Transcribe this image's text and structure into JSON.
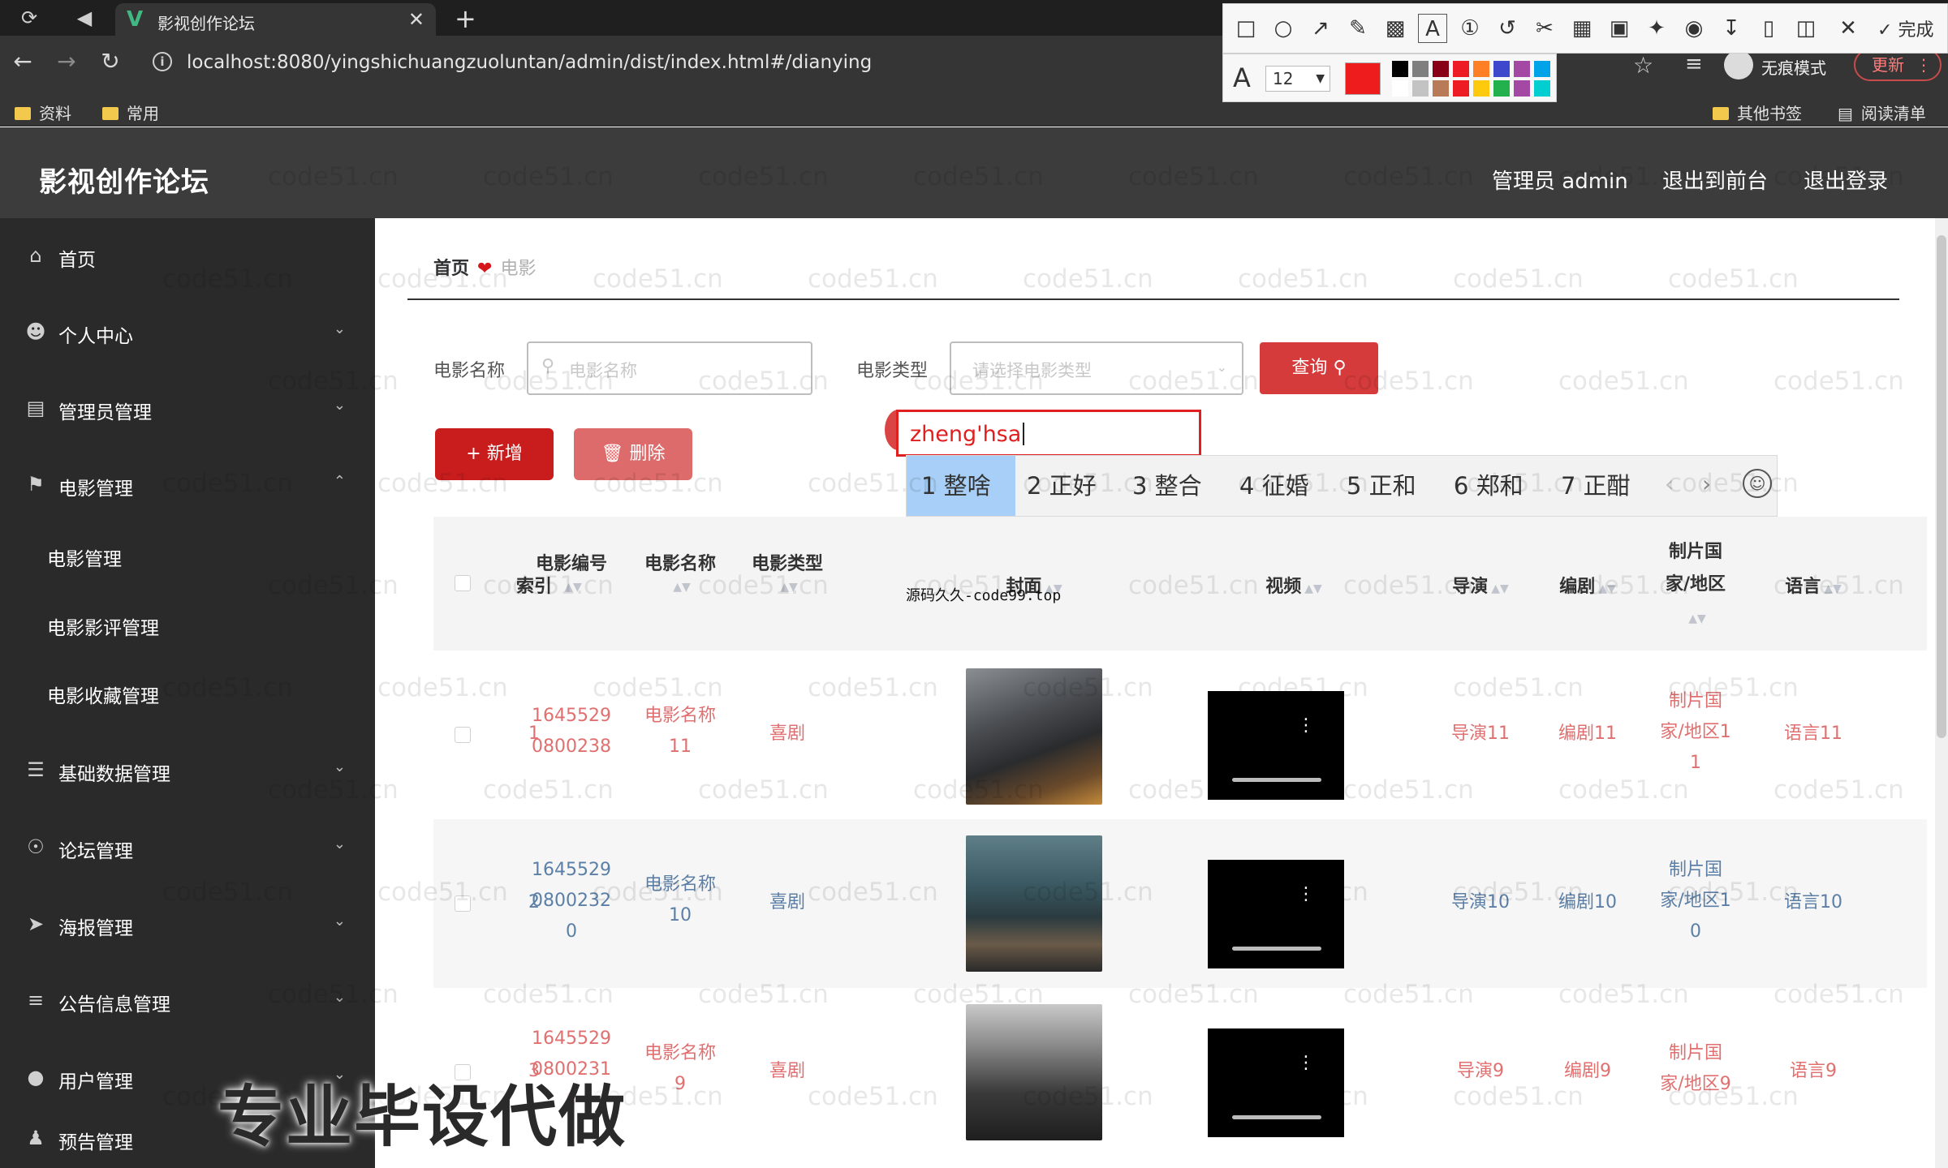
{
  "browser": {
    "tab_title": "影视创作论坛",
    "url": "localhost:8080/yingshichuangzuoluntan/admin/dist/index.html#/dianying",
    "incognito_label": "无痕模式",
    "update_label": "更新",
    "bookmarks": [
      {
        "label": "资料"
      },
      {
        "label": "常用"
      }
    ],
    "bookmarks_right": [
      {
        "label": "其他书签"
      },
      {
        "label": "阅读清单"
      }
    ]
  },
  "annotation_toolbar": {
    "done_label": "完成",
    "font_size": "12",
    "current_color": "#ee1c1c",
    "swatches": [
      "#000000",
      "#7f7f7f",
      "#880015",
      "#ed1c24",
      "#ff7f27",
      "#3f48cc",
      "#a349a4",
      "#00a2e8",
      "#ffffff",
      "#c3c3c3",
      "#b97a57",
      "#ed1c24",
      "#ffc90e",
      "#22b14c",
      "#a349a4",
      "#00ced1"
    ]
  },
  "header": {
    "title": "影视创作论坛",
    "admin_label": "管理员 admin",
    "front_label": "退出到前台",
    "logout_label": "退出登录"
  },
  "sidebar": {
    "items": [
      {
        "label": "首页",
        "icon": "home-icon"
      },
      {
        "label": "个人中心",
        "icon": "user-icon"
      },
      {
        "label": "管理员管理",
        "icon": "chat-icon"
      },
      {
        "label": "电影管理",
        "icon": "flag-icon"
      },
      {
        "label": "基础数据管理",
        "icon": "list-icon"
      },
      {
        "label": "论坛管理",
        "icon": "globe-icon"
      },
      {
        "label": "海报管理",
        "icon": "send-icon"
      },
      {
        "label": "公告信息管理",
        "icon": "sliders-icon"
      },
      {
        "label": "用户管理",
        "icon": "pin-icon"
      },
      {
        "label": "预告管理",
        "icon": "person-icon"
      }
    ],
    "sub_items": [
      {
        "label": "电影管理"
      },
      {
        "label": "电影影评管理"
      },
      {
        "label": "电影收藏管理"
      }
    ]
  },
  "breadcrumb": {
    "home": "首页",
    "current": "电影"
  },
  "search": {
    "name_label": "电影名称",
    "name_placeholder": "电影名称",
    "type_label": "电影类型",
    "type_placeholder": "请选择电影类型",
    "query_label": "查询"
  },
  "actions": {
    "add_label": "新增",
    "delete_label": "删除"
  },
  "ime": {
    "composition": "zheng'hsa",
    "candidates": [
      "1 整啥",
      "2 正好",
      "3 整合",
      "4 征婚",
      "5 正和",
      "6 郑和",
      "7 正酣"
    ]
  },
  "table": {
    "headers": {
      "index": "索引",
      "code": "电影编号",
      "name": "电影名称",
      "type": "电影类型",
      "cover": "封面",
      "video": "视频",
      "director": "导演",
      "writer": "编剧",
      "country_1": "制片国",
      "country_2": "家/地区",
      "language": "语言"
    },
    "rows": [
      {
        "index": "1",
        "code_1": "1645529",
        "code_2": "0800238",
        "code_3": "",
        "name_1": "电影名称",
        "name_2": "11",
        "type": "喜剧",
        "director": "导演11",
        "writer": "编剧11",
        "country_1": "制片国",
        "country_2": "家/地区1",
        "country_3": "1",
        "language": "语言11",
        "text_color": "#e07070"
      },
      {
        "index": "2",
        "code_1": "1645529",
        "code_2": "0800232",
        "code_3": "0",
        "name_1": "电影名称",
        "name_2": "10",
        "type": "喜剧",
        "director": "导演10",
        "writer": "编剧10",
        "country_1": "制片国",
        "country_2": "家/地区1",
        "country_3": "0",
        "language": "语言10",
        "text_color": "#5b7fa6"
      },
      {
        "index": "3",
        "code_1": "1645529",
        "code_2": "0800231",
        "code_3": "0",
        "name_1": "电影名称",
        "name_2": "9",
        "type": "喜剧",
        "director": "导演9",
        "writer": "编剧9",
        "country_1": "制片国",
        "country_2": "家/地区9",
        "country_3": "",
        "language": "语言9",
        "text_color": "#e07070"
      }
    ]
  },
  "overlays": {
    "watermark": "code51.cn",
    "source_caption": "源码久久-code99.top",
    "banner": "专业毕设代做"
  }
}
